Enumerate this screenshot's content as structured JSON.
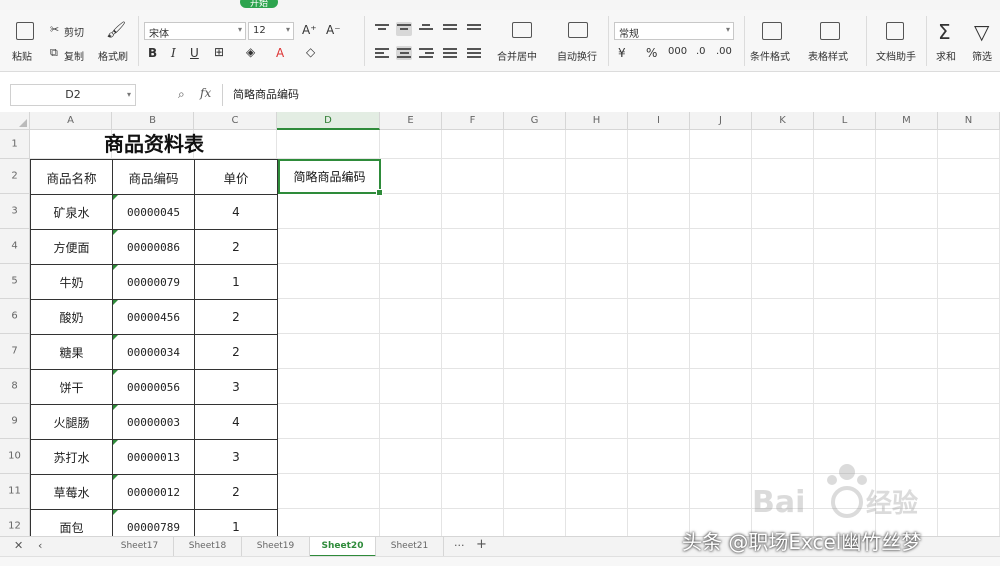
{
  "ribbon": {
    "active_tab": "开始",
    "paste_label": "粘贴",
    "cut_label": "剪切",
    "copy_label": "复制",
    "format_painter_label": "格式刷",
    "font_name": "宋体",
    "font_size": "12",
    "merge_center_label": "合并居中",
    "wrap_text_label": "自动换行",
    "number_format": "常规",
    "conditional_format_label": "条件格式",
    "table_style_label": "表格样式",
    "doc_assistant_label": "文档助手",
    "sum_label": "求和",
    "filter_label": "筛选"
  },
  "formula_bar": {
    "name_box": "D2",
    "fx_label": "fx",
    "formula": "简略商品编码"
  },
  "columns": [
    "A",
    "B",
    "C",
    "D",
    "E",
    "F",
    "G",
    "H",
    "I",
    "J",
    "K",
    "L",
    "M",
    "N"
  ],
  "rows": [
    "1",
    "2",
    "3",
    "4",
    "5",
    "6",
    "7",
    "8",
    "9",
    "10",
    "11",
    "12"
  ],
  "sheet": {
    "title": "商品资料表",
    "headers": [
      "商品名称",
      "商品编码",
      "单价"
    ],
    "active_header": "简略商品编码",
    "records": [
      {
        "name": "矿泉水",
        "code": "00000045",
        "price": "4"
      },
      {
        "name": "方便面",
        "code": "00000086",
        "price": "2"
      },
      {
        "name": "牛奶",
        "code": "00000079",
        "price": "1"
      },
      {
        "name": "酸奶",
        "code": "00000456",
        "price": "2"
      },
      {
        "name": "糖果",
        "code": "00000034",
        "price": "2"
      },
      {
        "name": "饼干",
        "code": "00000056",
        "price": "3"
      },
      {
        "name": "火腿肠",
        "code": "00000003",
        "price": "4"
      },
      {
        "name": "苏打水",
        "code": "00000013",
        "price": "3"
      },
      {
        "name": "草莓水",
        "code": "00000012",
        "price": "2"
      },
      {
        "name": "面包",
        "code": "00000789",
        "price": "1"
      }
    ]
  },
  "sheet_tabs": [
    {
      "label": "Sheet17"
    },
    {
      "label": "Sheet18"
    },
    {
      "label": "Sheet19"
    },
    {
      "label": "Sheet20"
    },
    {
      "label": "Sheet21"
    }
  ],
  "watermark": "头条 @职场Excel幽竹丝梦",
  "colors": {
    "accent": "#2e8b3a",
    "grid": "#e4e4e4"
  }
}
